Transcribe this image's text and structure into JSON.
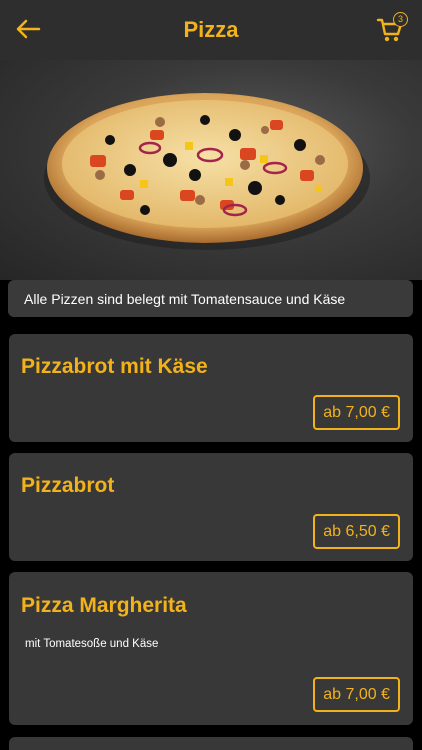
{
  "header": {
    "title": "Pizza",
    "cart_count": "3"
  },
  "info_bar": {
    "text": "Alle Pizzen sind belegt mit Tomatensauce und Käse"
  },
  "colors": {
    "accent": "#f2b21b",
    "header_bg": "#2e2e2e",
    "card_bg": "#383838",
    "page_bg": "#000000"
  },
  "products": [
    {
      "name": "Pizzabrot mit Käse",
      "description": "",
      "price": "ab 7,00 €"
    },
    {
      "name": "Pizzabrot",
      "description": "",
      "price": "ab 6,50 €"
    },
    {
      "name": "Pizza Margherita",
      "description": "mit Tomatesoße und Käse",
      "price": "ab 7,00 €"
    }
  ],
  "icons": {
    "back": "arrow-left-icon",
    "cart": "shopping-cart-icon"
  }
}
